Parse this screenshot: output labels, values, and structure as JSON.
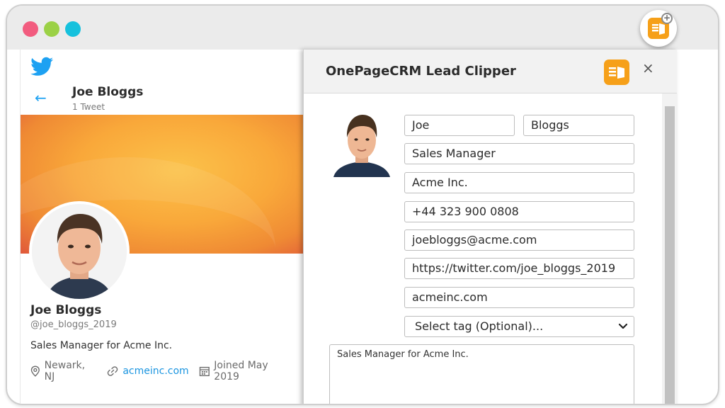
{
  "browser": {
    "traffic_lights": [
      "#f25c7f",
      "#9bd146",
      "#16c1dd"
    ],
    "extension_icon": "onepagecrm-add-icon"
  },
  "twitter": {
    "header_name": "Joe Bloggs",
    "tweet_count": "1 Tweet",
    "display_name": "Joe Bloggs",
    "handle": "@joe_bloggs_2019",
    "bio": "Sales Manager for Acme Inc.",
    "location": "Newark, NJ",
    "website": "acmeinc.com",
    "joined": "Joined May 2019",
    "accent": "#1da1f2"
  },
  "clipper": {
    "title": "OnePageCRM Lead Clipper",
    "brand_color": "#f6a019",
    "close_label": "×",
    "fields": {
      "first_name": "Joe",
      "last_name": "Bloggs",
      "job_title": "Sales Manager",
      "company": "Acme Inc.",
      "phone": "+44 323 900 0808",
      "email": "joebloggs@acme.com",
      "twitter_url": "https://twitter.com/joe_bloggs_2019",
      "website": "acmeinc.com"
    },
    "tag_select": "Select tag (Optional)...",
    "notes": "Sales Manager for Acme Inc."
  }
}
